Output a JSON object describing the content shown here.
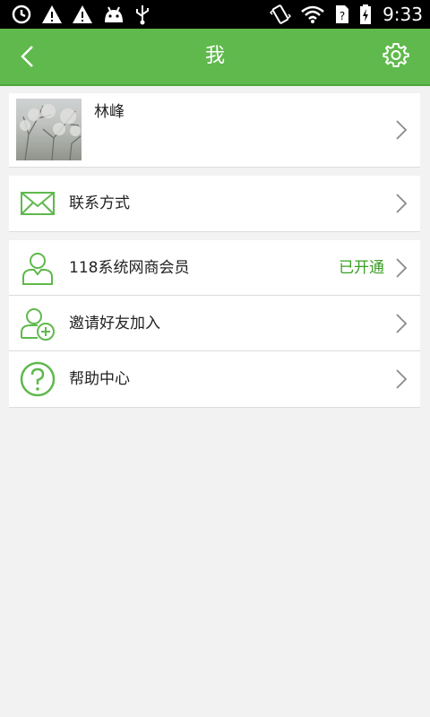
{
  "status_bar": {
    "time": "9:33",
    "left_icons": [
      "sync-icon",
      "warning-icon",
      "warning-icon",
      "android-icon",
      "usb-icon"
    ],
    "right_icons": [
      "vibrate-icon",
      "wifi-icon",
      "sim-icon",
      "battery-icon"
    ]
  },
  "app_bar": {
    "title": "我",
    "color": "#5fb94c"
  },
  "profile": {
    "name": "林峰"
  },
  "contact": {
    "label": "联系方式"
  },
  "menu": {
    "membership_label": "118系统网商会员",
    "membership_status": "已开通",
    "invite_label": "邀请好友加入",
    "help_label": "帮助中心"
  },
  "colors": {
    "accent": "#5fb94c",
    "icon_green": "#5fb94c",
    "status_green": "#3a9e24"
  }
}
